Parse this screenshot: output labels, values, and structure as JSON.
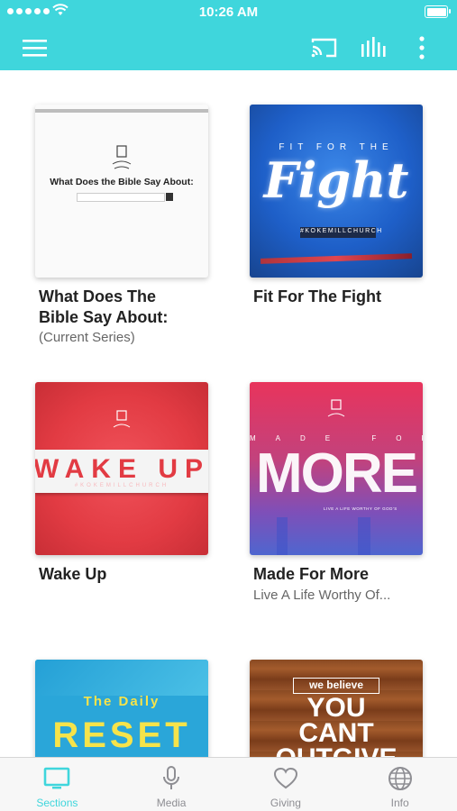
{
  "status_bar": {
    "time": "10:26 AM"
  },
  "nav": {
    "icons": [
      "menu-icon",
      "cast-icon",
      "audio-bars-icon",
      "more-vertical-icon"
    ],
    "accent_color": "#3fd6dc"
  },
  "cards": [
    {
      "title_line1": "What Does The",
      "title_line2": "Bible Say About:",
      "subtitle": "(Current Series)",
      "artwork_text": "What Does the Bible Say About:"
    },
    {
      "title_line1": "Fit For The Fight",
      "subtitle": "",
      "artwork_top": "FIT FOR THE",
      "artwork_main": "Fight",
      "artwork_tag": "#KOKEMILLCHURCH"
    },
    {
      "title_line1": "Wake Up",
      "subtitle": "",
      "artwork_main": "WAKE UP",
      "artwork_tag": "#KOKEMILLCHURCH"
    },
    {
      "title_line1": "Made For More",
      "subtitle": "Live A Life Worthy Of...",
      "artwork_top": "MADE FOR",
      "artwork_main": "MORE",
      "artwork_tag": "LIVE A LIFE WORTHY OF GOD'S"
    },
    {
      "title_line1": "The Daily Reset",
      "artwork_top": "The Daily",
      "artwork_main": "RESET"
    },
    {
      "title_line1": "We Believe You Cant Outgive",
      "artwork_top": "we believe",
      "artwork_line1": "YOU",
      "artwork_line2": "CANT",
      "artwork_line3": "OUTGIVE"
    }
  ],
  "tabs": [
    {
      "label": "Sections",
      "icon": "tv-icon",
      "active": true
    },
    {
      "label": "Media",
      "icon": "microphone-icon",
      "active": false
    },
    {
      "label": "Giving",
      "icon": "heart-icon",
      "active": false
    },
    {
      "label": "Info",
      "icon": "globe-icon",
      "active": false
    }
  ]
}
